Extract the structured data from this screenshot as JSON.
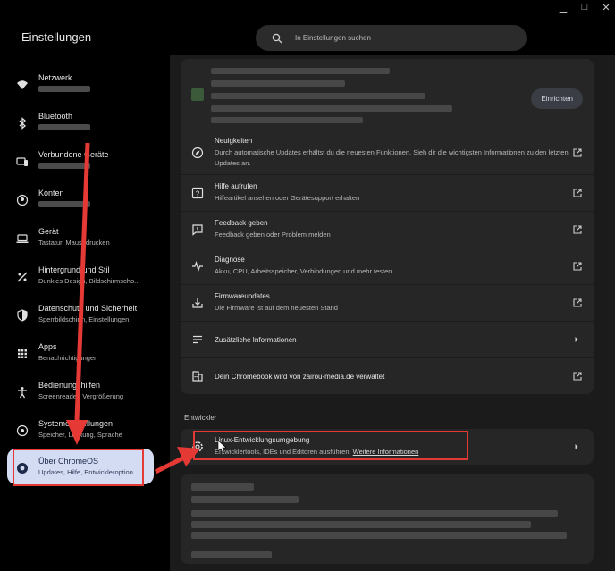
{
  "window": {
    "minimize": "▁",
    "maximize": "□",
    "close": "✕"
  },
  "app": {
    "title": "Einstellungen"
  },
  "search": {
    "placeholder": "In Einstellungen suchen"
  },
  "sidebar": {
    "items": [
      {
        "label": "Netzwerk",
        "sub": "",
        "icon": "wifi-icon",
        "blurred": true
      },
      {
        "label": "Bluetooth",
        "sub": "",
        "icon": "bluetooth-icon",
        "blurred": true
      },
      {
        "label": "Verbundene Geräte",
        "sub": "",
        "icon": "phone-link-icon",
        "blurred": true
      },
      {
        "label": "Konten",
        "sub": "",
        "icon": "account-icon",
        "blurred": true
      },
      {
        "label": "Gerät",
        "sub": "Tastatur, Maus, drucken",
        "icon": "laptop-icon"
      },
      {
        "label": "Hintergrund und Stil",
        "sub": "Dunkles Design, Bildschirmscho...",
        "icon": "palette-icon"
      },
      {
        "label": "Datenschutz und Sicherheit",
        "sub": "Sperrbildschirm, Einstellungen",
        "icon": "shield-icon"
      },
      {
        "label": "Apps",
        "sub": "Benachrichtigungen",
        "icon": "apps-grid-icon"
      },
      {
        "label": "Bedienungshilfen",
        "sub": "Screenreader, Vergrößerung",
        "icon": "accessibility-icon"
      },
      {
        "label": "Systemeinstellungen",
        "sub": "Speicher, Leistung, Sprache",
        "icon": "system-icon"
      },
      {
        "label": "Über ChromeOS",
        "sub": "Updates, Hilfe, Entwickleroption...",
        "icon": "chromeos-icon",
        "selected": true
      }
    ]
  },
  "main": {
    "update_button": "Einrichten",
    "rows": [
      {
        "title": "Neuigkeiten",
        "desc": "Durch automatische Updates erhältst du die neuesten Funktionen. Sieh dir die wichtigsten Informationen zu den letzten Updates an.",
        "icon": "compass-icon"
      },
      {
        "title": "Hilfe aufrufen",
        "desc": "Hilfeartikel ansehen oder Gerätesupport erhalten",
        "icon": "help-icon"
      },
      {
        "title": "Feedback geben",
        "desc": "Feedback geben oder Problem melden",
        "icon": "feedback-icon"
      },
      {
        "title": "Diagnose",
        "desc": "Akku, CPU, Arbeitsspeicher, Verbindungen und mehr testen",
        "icon": "diagnostics-icon"
      },
      {
        "title": "Firmwareupdates",
        "desc": "Die Firmware ist auf dem neuesten Stand",
        "icon": "firmware-icon"
      },
      {
        "title": "Zusätzliche Informationen",
        "desc": "",
        "icon": "notes-icon"
      },
      {
        "title": "Dein Chromebook wird von zairou-media.de verwaltet",
        "desc": "",
        "icon": "building-icon"
      }
    ],
    "developer": {
      "header": "Entwickler",
      "title": "Linux-Entwicklungsumgebung",
      "desc": "Entwicklertools, IDEs und Editoren ausführen.",
      "link": "Weitere Informationen"
    }
  },
  "colors": {
    "accent": "#d4dcf4",
    "highlight": "#e53935"
  }
}
